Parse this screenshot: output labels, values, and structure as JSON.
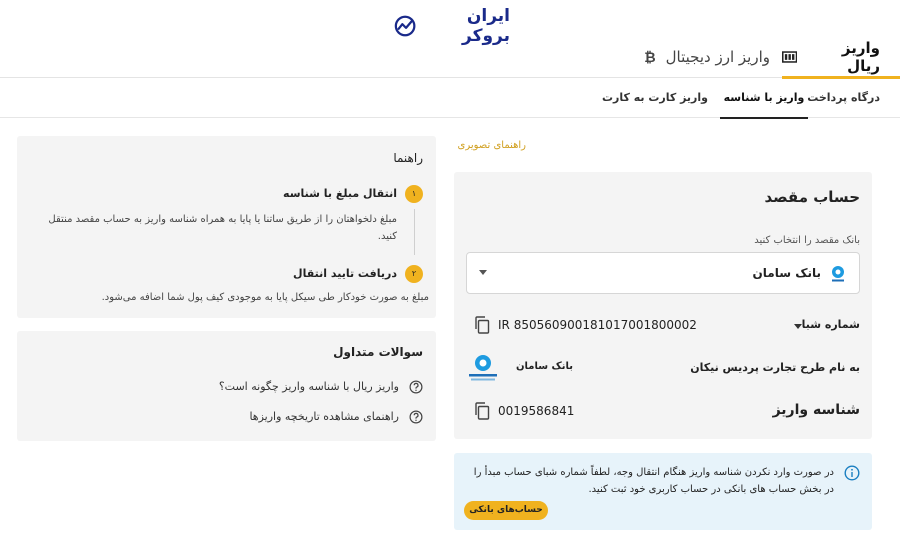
{
  "logo": {
    "text": "ایران بروکر",
    "icon": "chart-trend-icon"
  },
  "main_tabs": [
    {
      "label": "واریز ریال",
      "icon": "banknote-icon",
      "active": true
    },
    {
      "label": "واریز ارز دیجیتال",
      "icon": "bitcoin-icon",
      "active": false
    }
  ],
  "sub_tabs": [
    {
      "label": "درگاه پرداخت",
      "active": false
    },
    {
      "label": "واریز با شناسه",
      "active": true
    },
    {
      "label": "واریز کارت به کارت",
      "active": false
    }
  ],
  "guide_link": "راهنمای تصویری",
  "destination": {
    "title": "حساب مقصد",
    "select_label": "بانک مقصد را انتخاب کنید",
    "selected_bank": "بانک سامان",
    "sheba_label": "شماره شبا",
    "sheba_value": "IR 850560900181017001800002",
    "owner_label": "به نام طرح تجارت پردیس نیکان",
    "owner_bank": "بانک سامان",
    "deposit_id_label": "شناسه واریز",
    "deposit_id_value": "0019586841"
  },
  "notice": {
    "icon": "info-icon",
    "text": "در صورت وارد نکردن شناسه واریز هنگام انتقال وجه، لطفاً شماره شبای حساب مبدأ را در بخش حساب های بانکی در حساب کاربری خود ثبت کنید.",
    "button_label": "حساب‌های بانکی"
  },
  "guide": {
    "title": "راهنما",
    "steps": [
      {
        "number": "۱",
        "title": "انتقال مبلغ با شناسه",
        "desc": "مبلغ دلخواهتان را از طریق ساتنا یا پایا به همراه شناسه واریز به حساب مقصد منتقل کنید."
      },
      {
        "number": "۲",
        "title": "دریافت تایید انتقال",
        "desc": "مبلغ به صورت خودکار طی سیکل پایا به موجودی کیف پول شما اضافه می‌شود."
      }
    ]
  },
  "faq": {
    "title": "سوالات متداول",
    "items": [
      {
        "text": "واریز ریال با شناسه واریز چگونه است؟",
        "icon": "question-circle-icon"
      },
      {
        "text": "راهنمای مشاهده تاریخچه واریزها",
        "icon": "question-circle-icon"
      }
    ]
  },
  "colors": {
    "accent": "#f0b21f",
    "brand": "#1a2a8a",
    "notice_bg": "#e7f3fa",
    "card_bg": "#f4f4f4"
  }
}
